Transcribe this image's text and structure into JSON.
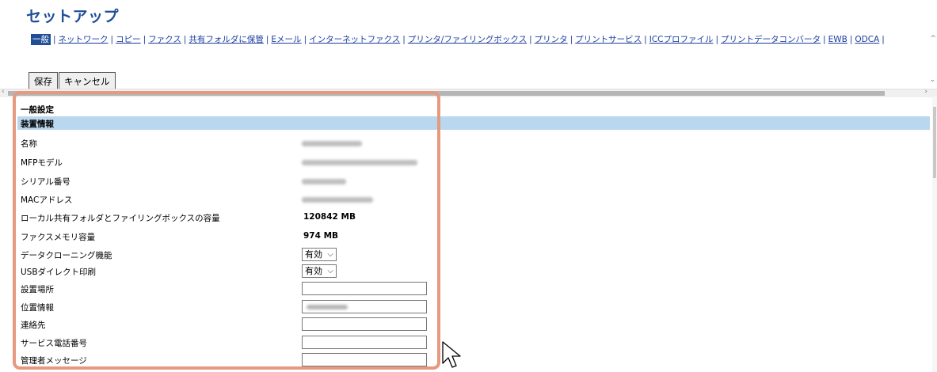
{
  "header": {
    "title": "セットアップ"
  },
  "nav": {
    "items": [
      "一般",
      "ネットワーク",
      "コピー",
      "ファクス",
      "共有フォルダに保管",
      "Eメール",
      "インターネットファクス",
      "プリンタ/ファイリングボックス",
      "プリンタ",
      "プリントサービス",
      "ICCプロファイル",
      "プリントデータコンバータ",
      "EWB",
      "ODCA"
    ],
    "active_index": 0
  },
  "toolbar": {
    "save_label": "保存",
    "cancel_label": "キャンセル"
  },
  "section": {
    "title": "一般設定",
    "subsection": "装置情報"
  },
  "rows": {
    "name": {
      "label": "名称"
    },
    "model": {
      "label": "MFPモデル"
    },
    "serial": {
      "label": "シリアル番号"
    },
    "mac": {
      "label": "MACアドレス"
    },
    "local_folder": {
      "label": "ローカル共有フォルダとファイリングボックスの容量",
      "value": "120842 MB"
    },
    "fax_memory": {
      "label": "ファクスメモリ容量",
      "value": "974 MB"
    },
    "data_cloning": {
      "label": "データクローニング機能",
      "value": "有効"
    },
    "usb_print": {
      "label": "USBダイレクト印刷",
      "value": "有効"
    },
    "location": {
      "label": "設置場所"
    },
    "geo": {
      "label": "位置情報"
    },
    "contact": {
      "label": "連絡先"
    },
    "service_phone": {
      "label": "サービス電話番号"
    },
    "admin_message": {
      "label": "管理者メッセージ"
    }
  },
  "icons": {
    "select_chevron": "chevron-down-icon",
    "cursor": "mouse-pointer-icon"
  },
  "colors": {
    "title": "#1f4e96",
    "link": "#1a3da0",
    "band": "#b9d7ee",
    "highlight": "#e59a80"
  }
}
